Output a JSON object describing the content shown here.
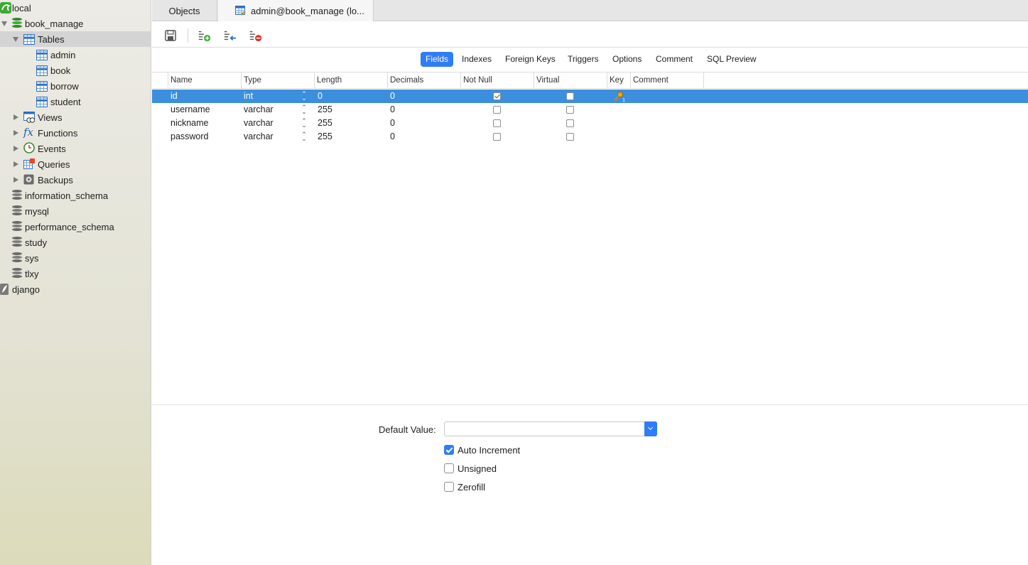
{
  "sidebar": {
    "connection_local": "local",
    "db_book_manage": "book_manage",
    "tables_label": "Tables",
    "tables": [
      "admin",
      "book",
      "borrow",
      "student"
    ],
    "views_label": "Views",
    "functions_label": "Functions",
    "events_label": "Events",
    "queries_label": "Queries",
    "backups_label": "Backups",
    "databases": [
      "information_schema",
      "mysql",
      "performance_schema",
      "study",
      "sys",
      "tlxy"
    ],
    "connection_django": "django"
  },
  "tabs": {
    "objects": "Objects",
    "active": "admin@book_manage (lo..."
  },
  "segments": [
    "Fields",
    "Indexes",
    "Foreign Keys",
    "Triggers",
    "Options",
    "Comment",
    "SQL Preview"
  ],
  "grid": {
    "headers": [
      "Name",
      "Type",
      "Length",
      "Decimals",
      "Not Null",
      "Virtual",
      "Key",
      "Comment"
    ],
    "rows": [
      {
        "name": "id",
        "type": "int",
        "length": "0",
        "decimals": "0",
        "not_null": true,
        "virtual": false,
        "key": "1"
      },
      {
        "name": "username",
        "type": "varchar",
        "length": "255",
        "decimals": "0",
        "not_null": false,
        "virtual": false,
        "key": ""
      },
      {
        "name": "nickname",
        "type": "varchar",
        "length": "255",
        "decimals": "0",
        "not_null": false,
        "virtual": false,
        "key": ""
      },
      {
        "name": "password",
        "type": "varchar",
        "length": "255",
        "decimals": "0",
        "not_null": false,
        "virtual": false,
        "key": ""
      }
    ]
  },
  "lower": {
    "default_value_label": "Default Value:",
    "default_value": "",
    "auto_increment_label": "Auto Increment",
    "auto_increment": true,
    "unsigned_label": "Unsigned",
    "unsigned": false,
    "zerofill_label": "Zerofill",
    "zerofill": false
  },
  "colors": {
    "accent": "#2f7cf6",
    "selection": "#3b8fdd"
  }
}
